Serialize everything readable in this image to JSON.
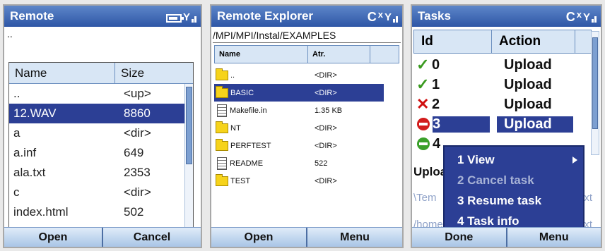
{
  "screen1": {
    "title": "Remote",
    "path": "..",
    "columns": [
      "Name",
      "Size"
    ],
    "rows": [
      {
        "name": "..",
        "size": "<up>",
        "selected": false
      },
      {
        "name": "12.WAV",
        "size": "8860",
        "selected": true
      },
      {
        "name": "a",
        "size": "<dir>",
        "selected": false
      },
      {
        "name": "a.inf",
        "size": "649",
        "selected": false
      },
      {
        "name": "ala.txt",
        "size": "2353",
        "selected": false
      },
      {
        "name": "c",
        "size": "<dir>",
        "selected": false
      },
      {
        "name": "index.html",
        "size": "502",
        "selected": false
      }
    ],
    "softkeys": [
      "Open",
      "Cancel"
    ]
  },
  "screen2": {
    "title": "Remote Explorer",
    "path": "/MPI/MPI/Instal/EXAMPLES",
    "columns": [
      "Name",
      "Atr."
    ],
    "rows": [
      {
        "icon": "folder-icon",
        "name": "..",
        "atr": "<DIR>",
        "selected": false
      },
      {
        "icon": "folder-icon",
        "name": "BASIC",
        "atr": "<DIR>",
        "selected": true
      },
      {
        "icon": "file-icon",
        "name": "Makefile.in",
        "atr": "1.35 KB",
        "selected": false
      },
      {
        "icon": "folder-icon",
        "name": "NT",
        "atr": "<DIR>",
        "selected": false
      },
      {
        "icon": "folder-icon",
        "name": "PERFTEST",
        "atr": "<DIR>",
        "selected": false
      },
      {
        "icon": "file-icon",
        "name": "README",
        "atr": "522",
        "selected": false
      },
      {
        "icon": "folder-icon",
        "name": "TEST",
        "atr": "<DIR>",
        "selected": false
      }
    ],
    "softkeys": [
      "Open",
      "Menu"
    ]
  },
  "screen3": {
    "title": "Tasks",
    "columns": [
      "Id",
      "Action"
    ],
    "rows": [
      {
        "icon": "check-icon",
        "id": "0",
        "action": "Upload",
        "selected": false
      },
      {
        "icon": "check-icon",
        "id": "1",
        "action": "Upload",
        "selected": false
      },
      {
        "icon": "cross-icon",
        "id": "2",
        "action": "Upload",
        "selected": false
      },
      {
        "icon": "stop-icon",
        "id": "3",
        "action": "Upload",
        "selected": true
      },
      {
        "icon": "play-icon",
        "id": "4",
        "action": "",
        "selected": false
      }
    ],
    "lower_label": "Uploa",
    "faint": {
      "line1_left": "\\Tem",
      "line1_right": "xt",
      "line2_left": "/home",
      "line2_right": ".txt"
    },
    "menu": [
      {
        "label": "1 View",
        "disabled": false,
        "submenu": true
      },
      {
        "label": "2 Cancel task",
        "disabled": true,
        "submenu": false
      },
      {
        "label": "3 Resume task",
        "disabled": false,
        "submenu": false
      },
      {
        "label": "4 Task info",
        "disabled": false,
        "submenu": false
      }
    ],
    "softkeys": [
      "Done",
      "Menu"
    ]
  },
  "colors": {
    "titlebar": "#2e56a6",
    "selection": "#2c3f95",
    "header": "#d8e6f5"
  }
}
